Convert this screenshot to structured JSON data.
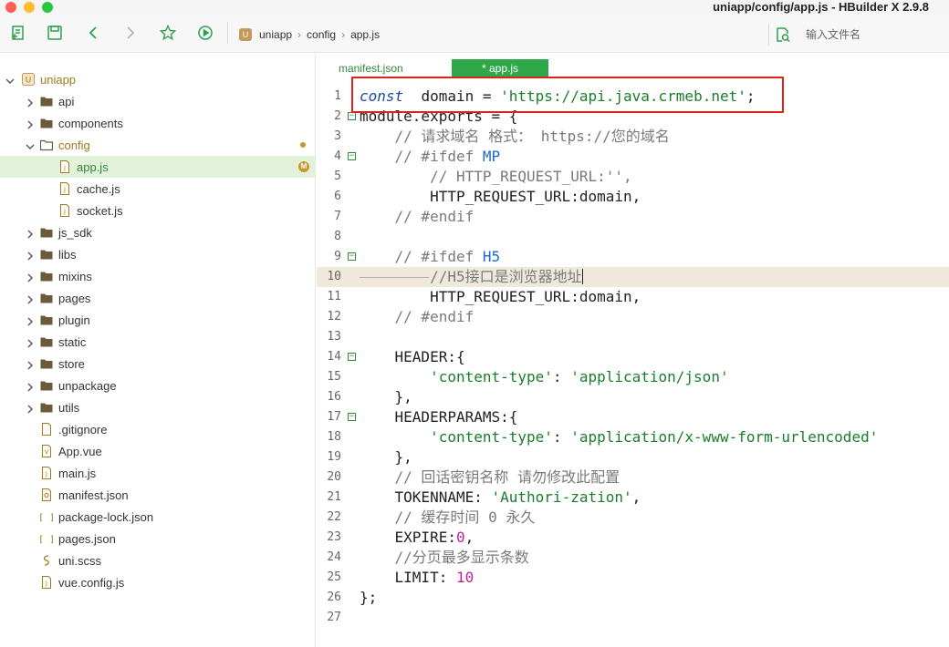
{
  "window": {
    "title": "uniapp/config/app.js - HBuilder X 2.9.8"
  },
  "toolbar": {
    "breadcrumb": [
      "uniapp",
      "config",
      "app.js"
    ],
    "search_placeholder": "输入文件名",
    "icons": [
      "new-file-icon",
      "save-icon",
      "back-icon",
      "forward-icon",
      "star-icon",
      "run-icon"
    ]
  },
  "sidebar": {
    "root": "uniapp",
    "items": [
      {
        "label": "api",
        "type": "folder",
        "depth": 1,
        "expanded": false
      },
      {
        "label": "components",
        "type": "folder",
        "depth": 1,
        "expanded": false
      },
      {
        "label": "config",
        "type": "folder",
        "depth": 1,
        "expanded": true,
        "marker": "dot"
      },
      {
        "label": "app.js",
        "type": "js",
        "depth": 2,
        "selected": true,
        "marker": "M"
      },
      {
        "label": "cache.js",
        "type": "js",
        "depth": 2
      },
      {
        "label": "socket.js",
        "type": "js",
        "depth": 2
      },
      {
        "label": "js_sdk",
        "type": "folder",
        "depth": 1,
        "expanded": false
      },
      {
        "label": "libs",
        "type": "folder",
        "depth": 1,
        "expanded": false
      },
      {
        "label": "mixins",
        "type": "folder",
        "depth": 1,
        "expanded": false
      },
      {
        "label": "pages",
        "type": "folder",
        "depth": 1,
        "expanded": false
      },
      {
        "label": "plugin",
        "type": "folder",
        "depth": 1,
        "expanded": false
      },
      {
        "label": "static",
        "type": "folder",
        "depth": 1,
        "expanded": false
      },
      {
        "label": "store",
        "type": "folder",
        "depth": 1,
        "expanded": false
      },
      {
        "label": "unpackage",
        "type": "folder",
        "depth": 1,
        "expanded": false
      },
      {
        "label": "utils",
        "type": "folder",
        "depth": 1,
        "expanded": false
      },
      {
        "label": ".gitignore",
        "type": "file",
        "depth": 1
      },
      {
        "label": "App.vue",
        "type": "vue",
        "depth": 1
      },
      {
        "label": "main.js",
        "type": "js",
        "depth": 1
      },
      {
        "label": "manifest.json",
        "type": "manifest",
        "depth": 1
      },
      {
        "label": "package-lock.json",
        "type": "json",
        "depth": 1
      },
      {
        "label": "pages.json",
        "type": "json",
        "depth": 1
      },
      {
        "label": "uni.scss",
        "type": "scss",
        "depth": 1
      },
      {
        "label": "vue.config.js",
        "type": "js",
        "depth": 1
      }
    ]
  },
  "tabs": [
    {
      "label": "manifest.json",
      "active": false
    },
    {
      "label": "* app.js",
      "active": true
    }
  ],
  "code": [
    {
      "n": "1",
      "fold": false,
      "tokens": [
        [
          "kw",
          "const"
        ],
        [
          "",
          "  domain = "
        ],
        [
          "str",
          "'https://api.java.crmeb.net'"
        ],
        [
          "",
          ";"
        ]
      ]
    },
    {
      "n": "2",
      "fold": true,
      "tokens": [
        [
          "",
          "module.exports = {"
        ]
      ]
    },
    {
      "n": "3",
      "fold": false,
      "tokens": [
        [
          "",
          "    "
        ],
        [
          "cm",
          "// 请求域名 格式： https://您的域名"
        ]
      ]
    },
    {
      "n": "4",
      "fold": true,
      "tokens": [
        [
          "",
          "    "
        ],
        [
          "cm",
          "// #ifdef "
        ],
        [
          "cmb",
          "MP"
        ]
      ]
    },
    {
      "n": "5",
      "fold": false,
      "tokens": [
        [
          "",
          "        "
        ],
        [
          "cm",
          "// HTTP_REQUEST_URL:'',"
        ]
      ]
    },
    {
      "n": "6",
      "fold": false,
      "tokens": [
        [
          "",
          "        HTTP_REQUEST_URL:domain,"
        ]
      ]
    },
    {
      "n": "7",
      "fold": false,
      "tokens": [
        [
          "",
          "    "
        ],
        [
          "cm",
          "// #endif"
        ]
      ]
    },
    {
      "n": "8",
      "fold": false,
      "tokens": []
    },
    {
      "n": "9",
      "fold": true,
      "tokens": [
        [
          "",
          "    "
        ],
        [
          "cm",
          "// #ifdef "
        ],
        [
          "cmb",
          "H5"
        ]
      ]
    },
    {
      "n": "10",
      "fold": false,
      "highlight": true,
      "tokens": [
        [
          "",
          "        "
        ],
        [
          "cm",
          "//H5接口是浏览器地址"
        ]
      ]
    },
    {
      "n": "11",
      "fold": false,
      "tokens": [
        [
          "",
          "        HTTP_REQUEST_URL:domain,"
        ]
      ]
    },
    {
      "n": "12",
      "fold": false,
      "tokens": [
        [
          "",
          "    "
        ],
        [
          "cm",
          "// #endif"
        ]
      ]
    },
    {
      "n": "13",
      "fold": false,
      "tokens": []
    },
    {
      "n": "14",
      "fold": true,
      "tokens": [
        [
          "",
          "    HEADER:{"
        ]
      ]
    },
    {
      "n": "15",
      "fold": false,
      "tokens": [
        [
          "",
          "        "
        ],
        [
          "str",
          "'content-type'"
        ],
        [
          "",
          ": "
        ],
        [
          "str",
          "'application/json'"
        ]
      ]
    },
    {
      "n": "16",
      "fold": false,
      "tokens": [
        [
          "",
          "    },"
        ]
      ]
    },
    {
      "n": "17",
      "fold": true,
      "tokens": [
        [
          "",
          "    HEADERPARAMS:{"
        ]
      ]
    },
    {
      "n": "18",
      "fold": false,
      "tokens": [
        [
          "",
          "        "
        ],
        [
          "str",
          "'content-type'"
        ],
        [
          "",
          ": "
        ],
        [
          "str",
          "'application/x-www-form-urlencoded'"
        ]
      ]
    },
    {
      "n": "19",
      "fold": false,
      "tokens": [
        [
          "",
          "    },"
        ]
      ]
    },
    {
      "n": "20",
      "fold": false,
      "tokens": [
        [
          "",
          "    "
        ],
        [
          "cm",
          "// 回话密钥名称 请勿修改此配置"
        ]
      ]
    },
    {
      "n": "21",
      "fold": false,
      "tokens": [
        [
          "",
          "    TOKENNAME: "
        ],
        [
          "str",
          "'Authori-zation'"
        ],
        [
          "",
          ","
        ]
      ]
    },
    {
      "n": "22",
      "fold": false,
      "tokens": [
        [
          "",
          "    "
        ],
        [
          "cm",
          "// 缓存时间 0 永久"
        ]
      ]
    },
    {
      "n": "23",
      "fold": false,
      "tokens": [
        [
          "",
          "    EXPIRE:"
        ],
        [
          "num",
          "0"
        ],
        [
          "",
          ","
        ]
      ]
    },
    {
      "n": "24",
      "fold": false,
      "tokens": [
        [
          "",
          "    "
        ],
        [
          "cm",
          "//分页最多显示条数"
        ]
      ]
    },
    {
      "n": "25",
      "fold": false,
      "tokens": [
        [
          "",
          "    LIMIT: "
        ],
        [
          "num",
          "10"
        ]
      ]
    },
    {
      "n": "26",
      "fold": false,
      "tokens": [
        [
          "",
          "};"
        ]
      ]
    },
    {
      "n": "27",
      "fold": false,
      "tokens": []
    }
  ],
  "colors": {
    "accent": "#2fa84a",
    "selection": "#e2f1da",
    "annotation_box": "#e0201b"
  }
}
